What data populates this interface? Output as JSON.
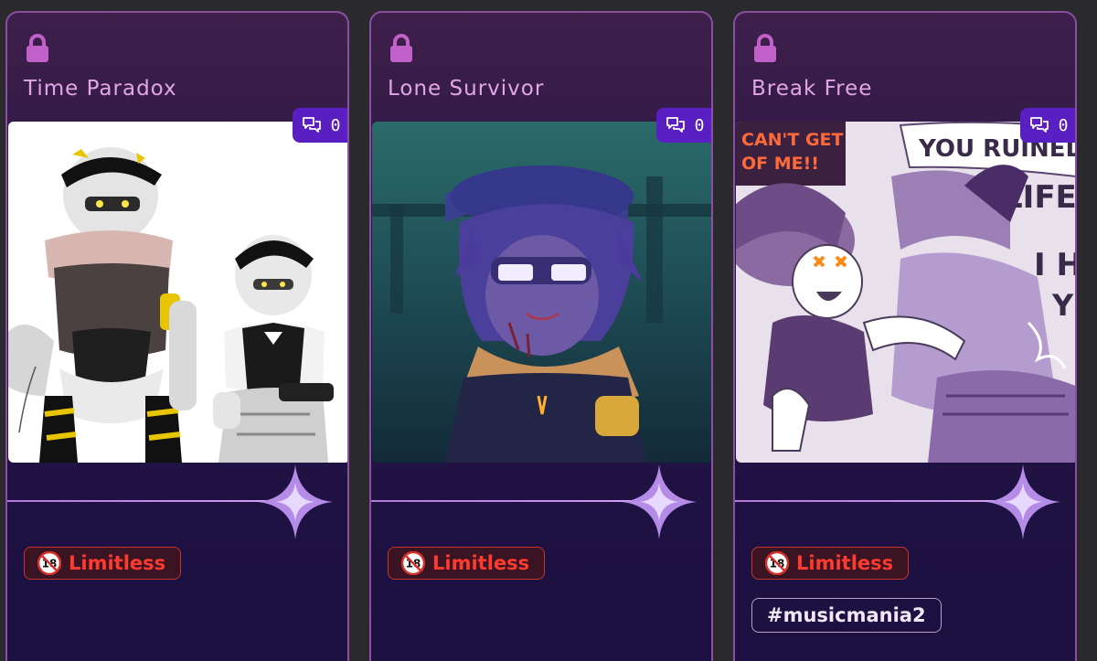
{
  "cards": [
    {
      "title": "Time Paradox",
      "comment_count": "0",
      "tag": "Limitless",
      "hashtag": ""
    },
    {
      "title": "Lone Survivor",
      "comment_count": "0",
      "tag": "Limitless",
      "hashtag": ""
    },
    {
      "title": "Break Free",
      "comment_count": "0",
      "tag": "Limitless",
      "hashtag": "#musicmania2"
    }
  ],
  "artwork_text": {
    "card_2_left": [
      "CAN'T GET",
      "OF ME!!"
    ],
    "card_2_right": [
      "YOU RUINED",
      "LIFE",
      "I H",
      "Y"
    ]
  },
  "icons": {
    "lock": "lock-icon",
    "comment": "comment-icon",
    "sparkle": "sparkle-icon",
    "nsfw": "nsfw-18-icon"
  },
  "colors": {
    "card_border": "#8a4fa0",
    "title": "#e2a6e6",
    "badge": "#5a1fc2",
    "limitless": "#ff3a2e"
  }
}
